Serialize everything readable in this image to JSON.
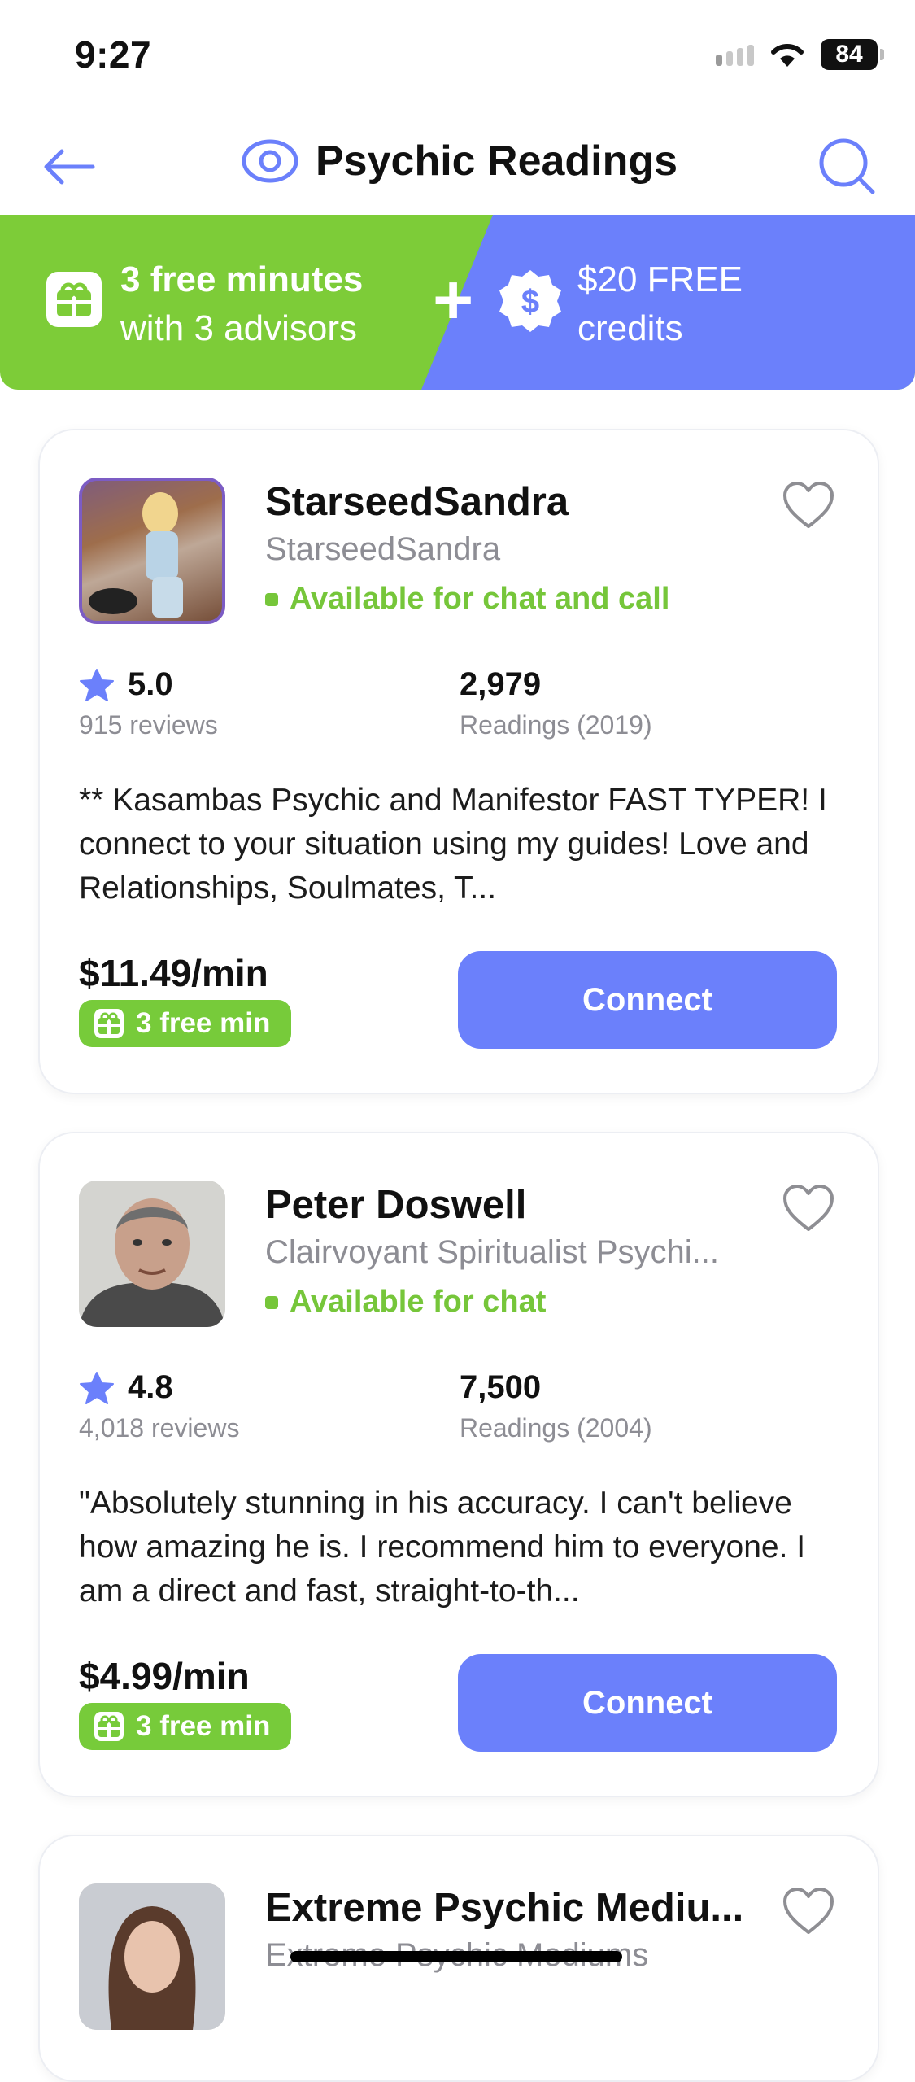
{
  "status_bar": {
    "time": "9:27",
    "battery": "84"
  },
  "header": {
    "title": "Psychic Readings"
  },
  "promo": {
    "line1": "3 free minutes",
    "line2": "with 3 advisors",
    "plus": "+",
    "credit_line1": "$20 FREE",
    "credit_line2": "credits",
    "coin_symbol": "$",
    "green_color": "#7dcc38",
    "blue_color": "#6b80fb"
  },
  "advisors": [
    {
      "name": "StarseedSandra",
      "subtitle": "StarseedSandra",
      "availability": "Available for chat and call",
      "rating": "5.0",
      "reviews": "915 reviews",
      "readings": "2,979",
      "readings_since": "Readings (2019)",
      "description": "** Kasambas Psychic and Manifestor FAST TYPER!  I connect  to your situation using  my guides!    Love and Relationships, Soulmates, T...",
      "price": "$11.49/min",
      "free_badge": "3 free min",
      "connect": "Connect"
    },
    {
      "name": "Peter Doswell",
      "subtitle": "Clairvoyant Spiritualist Psychi...",
      "availability": "Available for chat",
      "rating": "4.8",
      "reviews": "4,018 reviews",
      "readings": "7,500",
      "readings_since": "Readings (2004)",
      "description": "\"Absolutely stunning in his accuracy. I can't believe how amazing he is. I recommend him to everyone. I am a direct and fast, straight-to-th...",
      "price": "$4.99/min",
      "free_badge": "3 free min",
      "connect": "Connect"
    },
    {
      "name": "Extreme Psychic Mediu...",
      "subtitle": "Extreme Psychic Mediums"
    }
  ],
  "colors": {
    "accent": "#6b80fb",
    "available": "#76c63a",
    "badge": "#77cb3a"
  }
}
